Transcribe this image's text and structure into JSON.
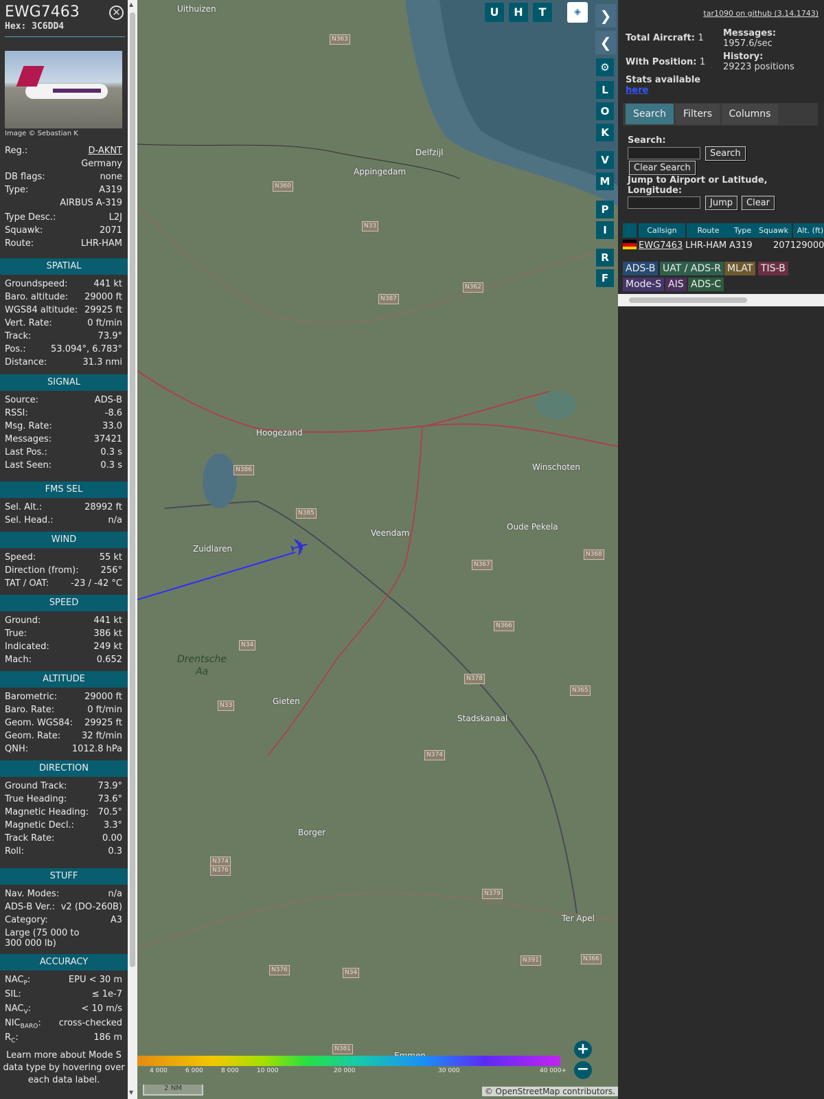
{
  "selected": {
    "callsign": "EWG7463",
    "hex": "Hex: 3C6DD4",
    "photo_credit": "Image © Sebastian K",
    "close_icon": "close-icon"
  },
  "basic": [
    {
      "k": "Reg.:",
      "v": "D-AKNT",
      "link": true
    },
    {
      "k": "",
      "v": "Germany"
    },
    {
      "k": "DB flags:",
      "v": "none"
    },
    {
      "k": "Type:",
      "v": "A319"
    },
    {
      "k": "",
      "v": "AIRBUS A-319"
    },
    {
      "k": "Type Desc.:",
      "v": "L2J"
    },
    {
      "k": "Squawk:",
      "v": "2071"
    },
    {
      "k": "Route:",
      "v": "LHR-HAM"
    }
  ],
  "sections": [
    {
      "title": "SPATIAL",
      "rows": [
        [
          "Groundspeed:",
          "441 kt"
        ],
        [
          "Baro. altitude:",
          "29000 ft"
        ],
        [
          "WGS84 altitude:",
          "29925 ft"
        ],
        [
          "Vert. Rate:",
          "0 ft/min"
        ],
        [
          "Track:",
          "73.9°"
        ],
        [
          "Pos.:",
          "53.094°, 6.783°"
        ],
        [
          "Distance:",
          "31.3 nmi"
        ]
      ]
    },
    {
      "title": "SIGNAL",
      "rows": [
        [
          "Source:",
          "ADS-B"
        ],
        [
          "RSSI:",
          "-8.6"
        ],
        [
          "Msg. Rate:",
          "33.0"
        ],
        [
          "Messages:",
          "37421"
        ],
        [
          "Last Pos.:",
          "0.3 s"
        ],
        [
          "Last Seen:",
          "0.3 s"
        ]
      ]
    },
    {
      "title": "FMS SEL",
      "rows": [
        [
          "Sel. Alt.:",
          "28992 ft"
        ],
        [
          "Sel. Head.:",
          "n/a"
        ]
      ]
    },
    {
      "title": "WIND",
      "rows": [
        [
          "Speed:",
          "55 kt"
        ],
        [
          "Direction (from):",
          "256°"
        ],
        [
          "TAT / OAT:",
          "-23 / -42 °C"
        ]
      ]
    },
    {
      "title": "SPEED",
      "rows": [
        [
          "Ground:",
          "441 kt"
        ],
        [
          "True:",
          "386 kt"
        ],
        [
          "Indicated:",
          "249 kt"
        ],
        [
          "Mach:",
          "0.652"
        ]
      ]
    },
    {
      "title": "ALTITUDE",
      "rows": [
        [
          "Barometric:",
          "29000 ft"
        ],
        [
          "Baro. Rate:",
          "0 ft/min"
        ],
        [
          "Geom. WGS84:",
          "29925 ft"
        ],
        [
          "Geom. Rate:",
          "32 ft/min"
        ],
        [
          "QNH:",
          "1012.8 hPa"
        ]
      ]
    },
    {
      "title": "DIRECTION",
      "rows": [
        [
          "Ground Track:",
          "73.9°"
        ],
        [
          "True Heading:",
          "73.6°"
        ],
        [
          "Magnetic Heading:",
          "70.5°"
        ],
        [
          "Magnetic Decl.:",
          "3.3°"
        ],
        [
          "Track Rate:",
          "0.00"
        ],
        [
          "Roll:",
          "0.3"
        ]
      ]
    },
    {
      "title": "STUFF",
      "rows": [
        [
          "Nav. Modes:",
          "n/a"
        ],
        [
          "ADS-B Ver.:",
          "v2 (DO-260B)"
        ],
        [
          "Category:",
          "A3"
        ]
      ]
    },
    {
      "title": "ACCURACY",
      "rows": [
        [
          "NACP:",
          "EPU < 30 m"
        ],
        [
          "SIL:",
          "≤ 1e-7"
        ],
        [
          "NACV:",
          "< 10 m/s"
        ],
        [
          "NICBARO:",
          "cross-checked"
        ],
        [
          "RC:",
          "186 m"
        ]
      ]
    }
  ],
  "stuff_extra": "Large (75 000 to 300 000 lb)",
  "accuracy_labels": [
    {
      "base": "NAC",
      "sub": "P"
    },
    {
      "base": "SIL",
      "sub": ""
    },
    {
      "base": "NAC",
      "sub": "V"
    },
    {
      "base": "NIC",
      "sub": "BARO"
    },
    {
      "base": "R",
      "sub": "C"
    }
  ],
  "learn_more": "Learn more about Mode S data type by hovering over each data label.",
  "map": {
    "top_buttons": [
      "U",
      "H",
      "T"
    ],
    "side_buttons": [
      "L",
      "O",
      "K",
      "V",
      "M",
      "P",
      "I",
      "R",
      "F"
    ],
    "towns": [
      [
        "Uithuizen",
        58,
        6
      ],
      [
        "Appingedam",
        315,
        243
      ],
      [
        "Delfzijl",
        405,
        215
      ],
      [
        "Hoogezand",
        173,
        623
      ],
      [
        "Winschoten",
        575,
        673
      ],
      [
        "Veendam",
        340,
        769
      ],
      [
        "Oude Pekela",
        538,
        760
      ],
      [
        "Zuidlaren",
        81,
        792
      ],
      [
        "Gieten",
        197,
        1014
      ],
      [
        "Stadskanaal",
        466,
        1039
      ],
      [
        "Borger",
        234,
        1205
      ],
      [
        "Ter Apel",
        618,
        1330
      ],
      [
        "Emmen",
        374,
        1530
      ],
      [
        "Drentsche",
        58,
        952
      ],
      [
        "Aa",
        85,
        970
      ]
    ],
    "roads": [
      [
        "N363",
        280,
        50
      ],
      [
        "N360",
        197,
        264
      ],
      [
        "N33",
        327,
        322
      ],
      [
        "N362",
        474,
        411
      ],
      [
        "N387",
        351,
        428
      ],
      [
        "N386",
        140,
        677
      ],
      [
        "N385",
        231,
        740
      ],
      [
        "N367",
        487,
        815
      ],
      [
        "N366",
        519,
        904
      ],
      [
        "N368",
        650,
        800
      ],
      [
        "N34",
        148,
        932
      ],
      [
        "N378",
        476,
        981
      ],
      [
        "N365",
        630,
        998
      ],
      [
        "N33",
        117,
        1020
      ],
      [
        "N374",
        418,
        1092
      ],
      [
        "N379",
        502,
        1294
      ],
      [
        "N374",
        106,
        1247
      ],
      [
        "N376",
        106,
        1260
      ],
      [
        "N376",
        192,
        1405
      ],
      [
        "N34",
        299,
        1409
      ],
      [
        "N391",
        558,
        1391
      ],
      [
        "N366",
        646,
        1389
      ],
      [
        "N381",
        284,
        1520
      ]
    ],
    "scale_ticks": [
      "4 000",
      "6 000",
      "8 000",
      "10 000",
      "20 000",
      "30 000",
      "40 000+"
    ],
    "scale_label": "2 NM",
    "attribution": "© OpenStreetMap contributors."
  },
  "right": {
    "github": "tar1090 on github (3.14.1743)",
    "total_aircraft_label": "Total Aircraft:",
    "total_aircraft": "1",
    "with_position_label": "With Position:",
    "with_position": "1",
    "messages_label": "Messages:",
    "messages": "1957.6/sec",
    "history_label": "History:",
    "history": "29223 positions",
    "stats_label": "Stats available",
    "stats_link": "here",
    "tabs": [
      "Search",
      "Filters",
      "Columns"
    ],
    "search_label": "Search:",
    "search_button": "Search",
    "clear_search": "Clear Search",
    "jump_label": "Jump to Airport or Latitude, Longitude:",
    "jump_button": "Jump",
    "clear_button": "Clear",
    "columns": [
      "Callsign",
      "Route",
      "Type",
      "Squawk",
      "Alt. (ft)"
    ],
    "row": {
      "callsign": "EWG7463",
      "route": "LHR-HAM",
      "type": "A319",
      "squawk": "2071",
      "alt": "29000"
    },
    "tags": [
      [
        "ADS-B",
        "#274b73"
      ],
      [
        "UAT / ADS-R",
        "#2f5e4c"
      ],
      [
        "MLAT",
        "#6e5a30"
      ],
      [
        "TIS-B",
        "#6a2f44"
      ],
      [
        "Mode-S",
        "#46366b"
      ],
      [
        "AIS",
        "#4b2f5c"
      ],
      [
        "ADS-C",
        "#2f5a40"
      ]
    ]
  }
}
